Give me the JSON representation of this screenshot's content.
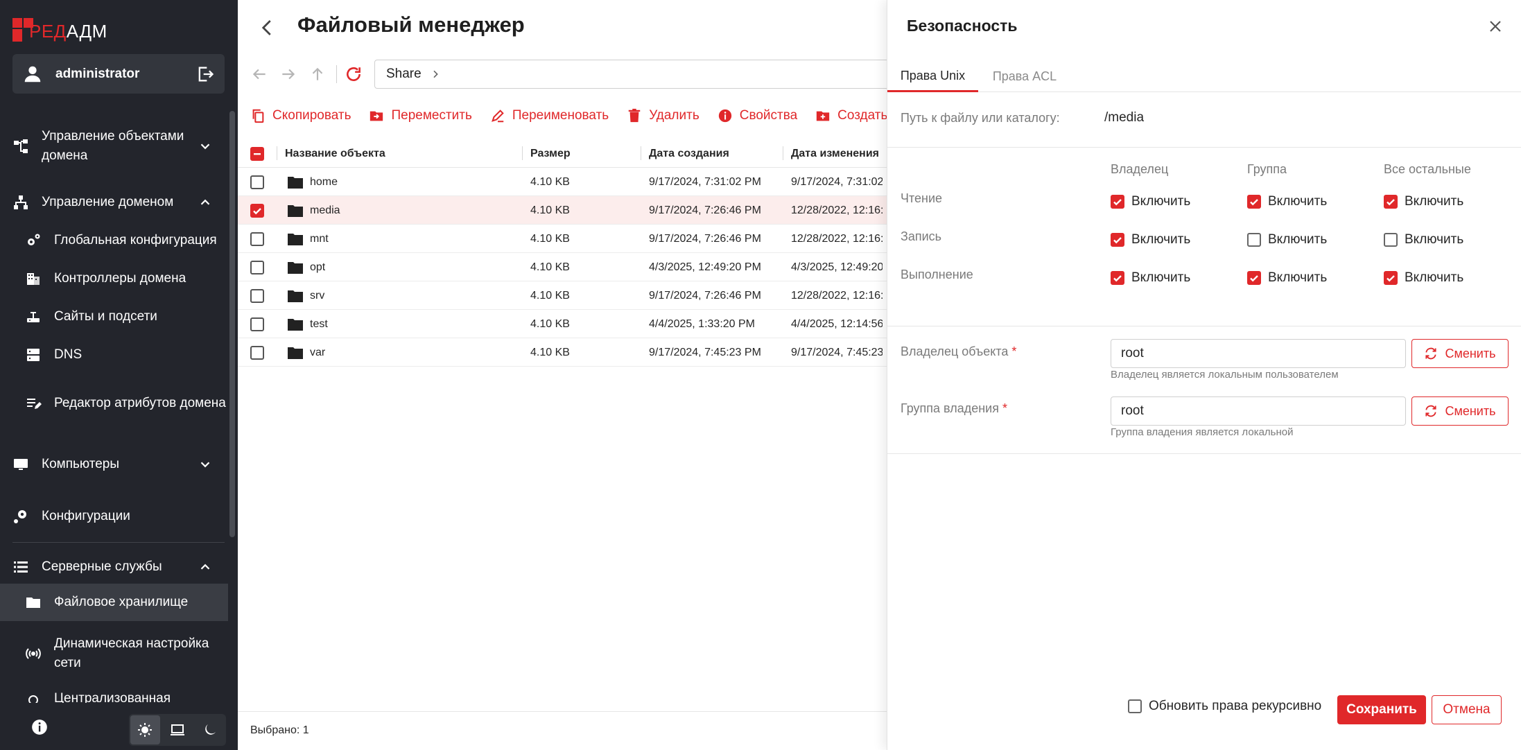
{
  "colors": {
    "accent": "#e0282a",
    "sidebar_bg": "#23252c",
    "selected_row_bg": "#fcedec"
  },
  "sidebar": {
    "logo": {
      "part1": "РЕД",
      "part2": "АДМ"
    },
    "user": {
      "name": "administrator",
      "icon": "user-icon",
      "logout_icon": "logout-icon"
    },
    "items": [
      {
        "label": "Управление объектами домена",
        "icon": "org-tree-icon",
        "chevron": "down",
        "level": 0
      },
      {
        "label": "Управление доменом",
        "icon": "network-icon",
        "chevron": "up",
        "level": 0
      },
      {
        "label": "Глобальная конфигурация",
        "icon": "gears-icon",
        "level": 1
      },
      {
        "label": "Контроллеры домена",
        "icon": "building-icon",
        "level": 1
      },
      {
        "label": "Сайты и подсети",
        "icon": "lan-icon",
        "level": 1
      },
      {
        "label": "DNS",
        "icon": "dns-icon",
        "level": 1
      },
      {
        "label": "Редактор атрибутов домена",
        "icon": "edit-list-icon",
        "level": 1
      },
      {
        "label": "Компьютеры",
        "icon": "monitor-icon",
        "chevron": "down",
        "level": 0
      },
      {
        "label": "Конфигурации",
        "icon": "config-icon",
        "level": 0
      },
      {
        "label": "Серверные службы",
        "icon": "server-list-icon",
        "chevron": "up",
        "level": 0
      },
      {
        "label": "Файловое хранилище",
        "icon": "folder-icon",
        "level": 1,
        "active": true
      },
      {
        "label": "Динамическая настройка сети",
        "icon": "signal-icon",
        "level": 1
      },
      {
        "label": "Централизованная",
        "icon": "generic-icon",
        "level": 1
      }
    ],
    "bottom": {
      "info_icon": "info-icon",
      "themes": [
        "light-theme-icon",
        "system-theme-icon",
        "dark-theme-icon"
      ],
      "active_theme": 0
    }
  },
  "file_manager": {
    "title": "Файловый менеджер",
    "path": "Share",
    "toolbar": [
      {
        "label": "Скопировать",
        "icon": "copy-icon"
      },
      {
        "label": "Переместить",
        "icon": "move-icon"
      },
      {
        "label": "Переименовать",
        "icon": "rename-icon"
      },
      {
        "label": "Удалить",
        "icon": "delete-icon"
      },
      {
        "label": "Свойства",
        "icon": "properties-icon"
      },
      {
        "label": "Создать ди",
        "icon": "create-folder-icon"
      }
    ],
    "columns": [
      "Название объекта",
      "Размер",
      "Дата создания",
      "Дата изменения"
    ],
    "rows": [
      {
        "name": "home",
        "size": "4.10 KB",
        "created": "9/17/2024, 7:31:02 PM",
        "modified": "9/17/2024, 7:31:02",
        "selected": false
      },
      {
        "name": "media",
        "size": "4.10 KB",
        "created": "9/17/2024, 7:26:46 PM",
        "modified": "12/28/2022, 12:16:",
        "selected": true
      },
      {
        "name": "mnt",
        "size": "4.10 KB",
        "created": "9/17/2024, 7:26:46 PM",
        "modified": "12/28/2022, 12:16:",
        "selected": false
      },
      {
        "name": "opt",
        "size": "4.10 KB",
        "created": "4/3/2025, 12:49:20 PM",
        "modified": "4/3/2025, 12:49:20",
        "selected": false
      },
      {
        "name": "srv",
        "size": "4.10 KB",
        "created": "9/17/2024, 7:26:46 PM",
        "modified": "12/28/2022, 12:16:",
        "selected": false
      },
      {
        "name": "test",
        "size": "4.10 KB",
        "created": "4/4/2025, 1:33:20 PM",
        "modified": "4/4/2025, 12:14:56",
        "selected": false
      },
      {
        "name": "var",
        "size": "4.10 KB",
        "created": "9/17/2024, 7:45:23 PM",
        "modified": "9/17/2024, 7:45:23",
        "selected": false
      }
    ],
    "footer": "Выбрано: 1"
  },
  "security": {
    "title": "Безопасность",
    "tabs": [
      "Права Unix",
      "Права ACL"
    ],
    "active_tab": 0,
    "path_label": "Путь к файлу или каталогу:",
    "path_value": "/media",
    "perm_columns": [
      "Владелец",
      "Группа",
      "Все остальные"
    ],
    "perm_rows": [
      {
        "label": "Чтение",
        "values": [
          true,
          true,
          true
        ]
      },
      {
        "label": "Запись",
        "values": [
          true,
          false,
          false
        ]
      },
      {
        "label": "Выполнение",
        "values": [
          true,
          true,
          true
        ]
      }
    ],
    "enable_label": "Включить",
    "owner": {
      "label": "Владелец объекта",
      "required": "*",
      "value": "root",
      "hint": "Владелец является локальным пользователем",
      "button": "Сменить"
    },
    "group": {
      "label": "Группа владения",
      "required": "*",
      "value": "root",
      "hint": "Группа владения является локальной",
      "button": "Сменить"
    },
    "recursive_label": "Обновить права рекурсивно",
    "recursive_checked": false,
    "save_label": "Сохранить",
    "cancel_label": "Отмена"
  }
}
